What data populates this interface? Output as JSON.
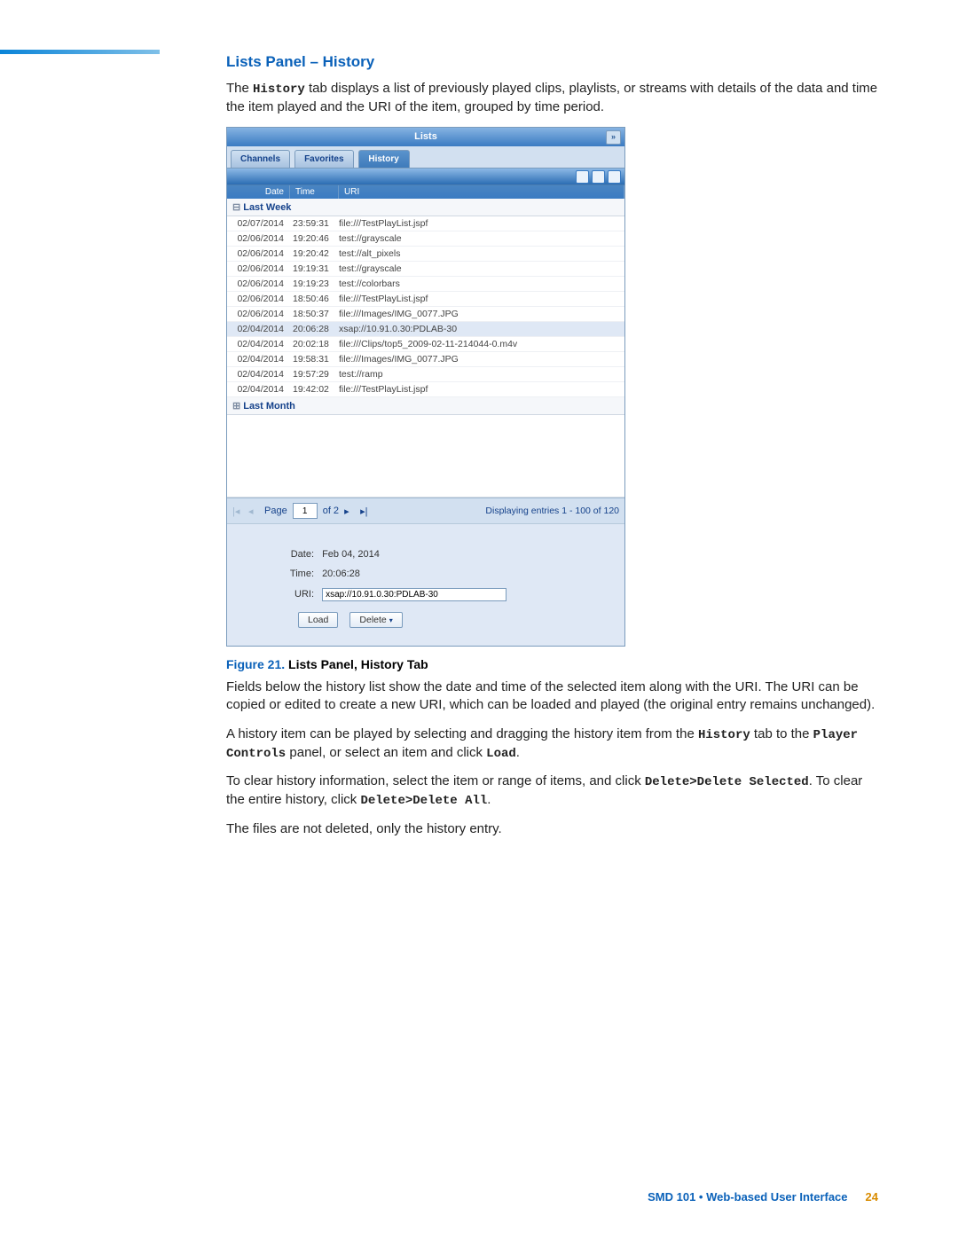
{
  "section": {
    "title": "Lists Panel – History"
  },
  "para1": "The ",
  "para1_m": "History",
  "para1_r": " tab displays a list of previously played clips, playlists, or streams with details of the data and time the item played and the URI of the item, grouped by time period.",
  "panel": {
    "title": "Lists",
    "tabs": [
      "Channels",
      "Favorites",
      "History"
    ],
    "active_tab": 2,
    "cols": {
      "date": "Date",
      "time": "Time",
      "uri": "URI"
    },
    "groups": [
      {
        "label": "Last Week",
        "expanded": true,
        "rows": [
          {
            "date": "02/07/2014",
            "time": "23:59:31",
            "uri": "file:///TestPlayList.jspf",
            "sel": false
          },
          {
            "date": "02/06/2014",
            "time": "19:20:46",
            "uri": "test://grayscale",
            "sel": false
          },
          {
            "date": "02/06/2014",
            "time": "19:20:42",
            "uri": "test://alt_pixels",
            "sel": false
          },
          {
            "date": "02/06/2014",
            "time": "19:19:31",
            "uri": "test://grayscale",
            "sel": false
          },
          {
            "date": "02/06/2014",
            "time": "19:19:23",
            "uri": "test://colorbars",
            "sel": false
          },
          {
            "date": "02/06/2014",
            "time": "18:50:46",
            "uri": "file:///TestPlayList.jspf",
            "sel": false
          },
          {
            "date": "02/06/2014",
            "time": "18:50:37",
            "uri": "file:///Images/IMG_0077.JPG",
            "sel": false
          },
          {
            "date": "02/04/2014",
            "time": "20:06:28",
            "uri": "xsap://10.91.0.30:PDLAB-30",
            "sel": true
          },
          {
            "date": "02/04/2014",
            "time": "20:02:18",
            "uri": "file:///Clips/top5_2009-02-11-214044-0.m4v",
            "sel": false
          },
          {
            "date": "02/04/2014",
            "time": "19:58:31",
            "uri": "file:///Images/IMG_0077.JPG",
            "sel": false
          },
          {
            "date": "02/04/2014",
            "time": "19:57:29",
            "uri": "test://ramp",
            "sel": false
          },
          {
            "date": "02/04/2014",
            "time": "19:42:02",
            "uri": "file:///TestPlayList.jspf",
            "sel": false
          }
        ]
      },
      {
        "label": "Last Month",
        "expanded": false,
        "rows": []
      }
    ],
    "pager": {
      "page_label": "Page",
      "page_value": "1",
      "of_label": "of 2",
      "display": "Displaying entries 1 - 100 of 120"
    },
    "details": {
      "date_label": "Date:",
      "date_value": "Feb 04, 2014",
      "time_label": "Time:",
      "time_value": "20:06:28",
      "uri_label": "URI:",
      "uri_value": "xsap://10.91.0.30:PDLAB-30",
      "load_btn": "Load",
      "delete_btn": "Delete"
    }
  },
  "figcap": {
    "label": "Figure 21.",
    "text": " Lists Panel, History Tab"
  },
  "para2": "Fields below the history list show the date and time of the selected item along with the URI. The URI can be copied or edited to create a new URI, which can be loaded and played (the original entry remains unchanged).",
  "para3_a": "A history item can be played by selecting and dragging the history item from the ",
  "para3_m1": "History",
  "para3_b": " tab to the ",
  "para3_m2": "Player Controls",
  "para3_c": " panel, or select an item and click ",
  "para3_m3": "Load",
  "para3_d": ".",
  "para4_a": "To clear history information, select the item or range of items, and click ",
  "para4_m1": "Delete>Delete Selected",
  "para4_b": ". To clear the entire history, click ",
  "para4_m2": "Delete>Delete All",
  "para4_c": ".",
  "para5": "The files are not deleted, only the history entry.",
  "footer": {
    "text": "SMD 101 • Web-based User Interface",
    "page": "24"
  }
}
